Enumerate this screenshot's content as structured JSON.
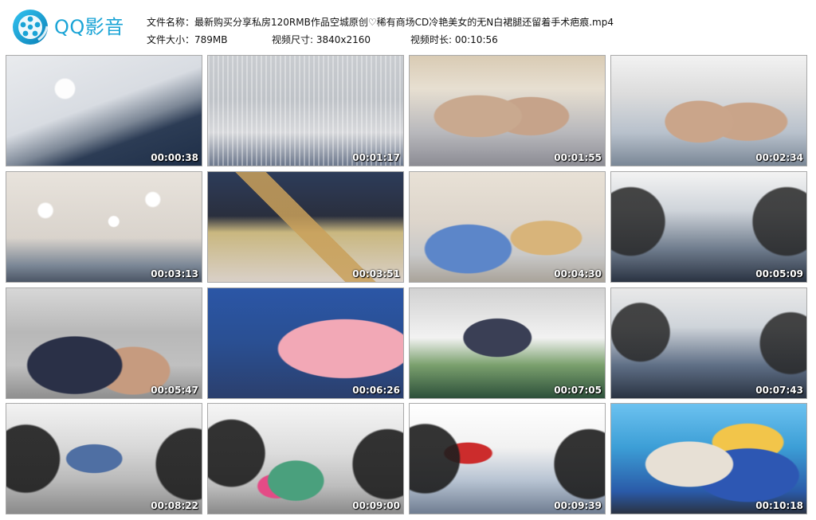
{
  "app": {
    "logo_text": "QQ影音"
  },
  "file_info": {
    "filename_label": "文件名称：",
    "filename_value": "最新购买分享私房120RMB作品空城原创♡稀有商场CD冷艳美女的无N白裙腿还留着手术疤痕.mp4",
    "size_label": "文件大小：",
    "size_value": "789MB",
    "dimensions_label": "视频尺寸: ",
    "dimensions_value": "3840x2160",
    "duration_label": "视频时长: ",
    "duration_value": "00:10:56"
  },
  "thumbnails": [
    {
      "timestamp": "00:00:38"
    },
    {
      "timestamp": "00:01:17"
    },
    {
      "timestamp": "00:01:55"
    },
    {
      "timestamp": "00:02:34"
    },
    {
      "timestamp": "00:03:13"
    },
    {
      "timestamp": "00:03:51"
    },
    {
      "timestamp": "00:04:30"
    },
    {
      "timestamp": "00:05:09"
    },
    {
      "timestamp": "00:05:47"
    },
    {
      "timestamp": "00:06:26"
    },
    {
      "timestamp": "00:07:05"
    },
    {
      "timestamp": "00:07:43"
    },
    {
      "timestamp": "00:08:22"
    },
    {
      "timestamp": "00:09:00"
    },
    {
      "timestamp": "00:09:39"
    },
    {
      "timestamp": "00:10:18"
    }
  ]
}
